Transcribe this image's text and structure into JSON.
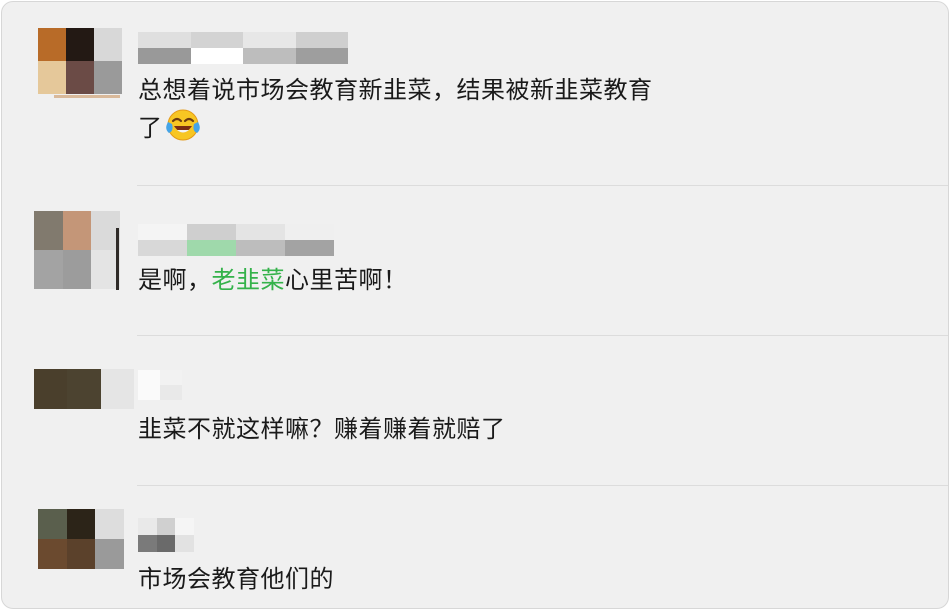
{
  "comments": [
    {
      "avatar_colors": [
        "#b86b28",
        "#231914",
        "#d8d8d8",
        "#e5c89a",
        "#6b4b46",
        "#9a9a9a"
      ],
      "name_colors": [
        "#dfdfdf",
        "#d3d3d3",
        "#e7e7e7",
        "#cfcfcf",
        "#999999",
        "#ffffff",
        "#bdbdbd",
        "#9e9e9e"
      ],
      "text_line1": "总想着说市场会教育新韭菜，结果被新韭菜教育",
      "text_line2": "了",
      "emoji": "face-with-tears-of-joy"
    },
    {
      "avatar_colors": [
        "#817a6e",
        "#c49678",
        "#dadada",
        "#a3a3a3",
        "#9c9c9c",
        "#e4e4e4"
      ],
      "name_colors": [
        "#f4f4f4",
        "#cfcfcf",
        "#e4e4e4",
        "#efefef",
        "#d8d8d8",
        "#9fd9ab",
        "#bdbdbd",
        "#a3a3a3"
      ],
      "text_before": "是啊，",
      "text_highlight": "老韭菜",
      "text_after": "心里苦啊！",
      "highlight_color": "#34b24a"
    },
    {
      "avatar_colors": [
        "#4a3f2c",
        "#4c4330",
        "#e5e5e5",
        "#4a3f2c",
        "#4c4330",
        "#e5e5e5"
      ],
      "name_colors": [
        "#fafafa",
        "#f2f2f2",
        "#fafafa",
        "#e9e9e9"
      ],
      "text": "韭菜不就这样嘛？赚着赚着就赔了"
    },
    {
      "avatar_colors": [
        "#5a5f4d",
        "#2c2418",
        "#dddddd",
        "#6b4a2f",
        "#5b412b",
        "#9a9a9a"
      ],
      "name_colors": [
        "#e9e9e9",
        "#d0d0d0",
        "#f5f5f5",
        "#7a7a7a",
        "#6a6a6a",
        "#e2e2e2"
      ],
      "text": "市场会教育他们的"
    }
  ]
}
